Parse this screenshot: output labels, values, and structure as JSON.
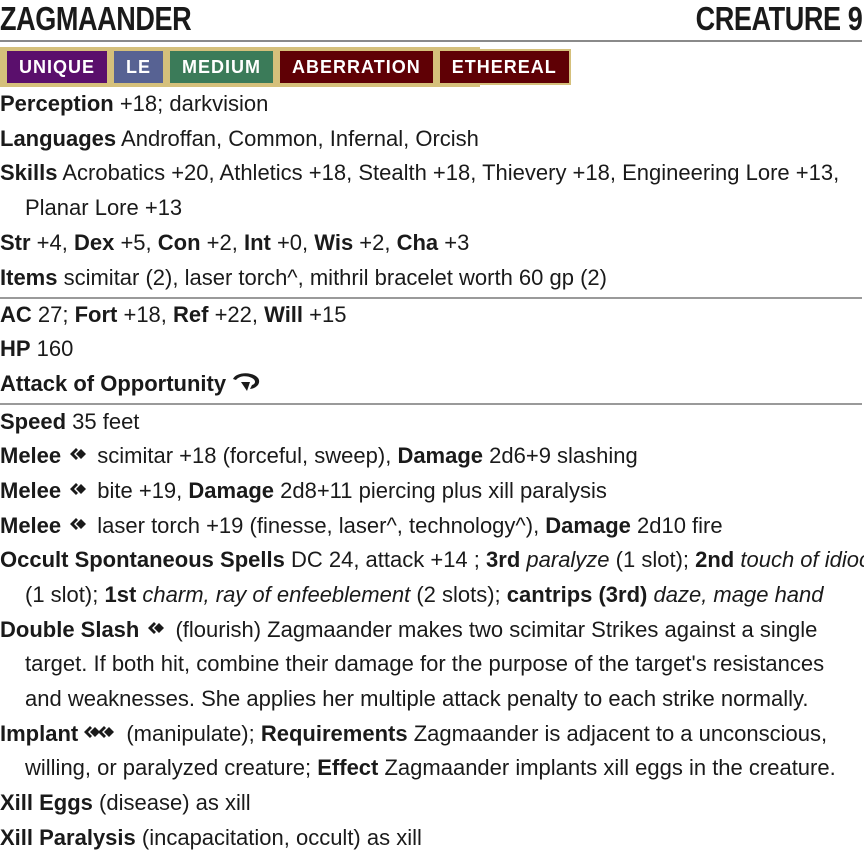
{
  "header": {
    "name": "ZAGMAANDER",
    "level": "CREATURE 9"
  },
  "traits": [
    {
      "label": "UNIQUE",
      "color": "#5a0f6c"
    },
    {
      "label": "LE",
      "color": "#576293"
    },
    {
      "label": "MEDIUM",
      "color": "#3b7b59"
    },
    {
      "label": "ABERRATION",
      "color": "#5f0005"
    },
    {
      "label": "ETHEREAL",
      "color": "#5f0005"
    }
  ],
  "perception": {
    "label": "Perception",
    "value": " +18; darkvision"
  },
  "languages": {
    "label": "Languages",
    "value": " Androffan, Common, Infernal, Orcish"
  },
  "skills": {
    "label": "Skills",
    "line1": " Acrobatics +20, Athletics +18, Stealth +18, Thievery +18, Engineering Lore +13,",
    "line2": "Planar Lore +13"
  },
  "abilities": {
    "str_label": "Str",
    "str": " +4, ",
    "dex_label": "Dex",
    "dex": " +5, ",
    "con_label": "Con",
    "con": " +2, ",
    "int_label": "Int",
    "int": " +0, ",
    "wis_label": "Wis",
    "wis": " +2, ",
    "cha_label": "Cha",
    "cha": " +3"
  },
  "items": {
    "label": "Items",
    "value": " scimitar (2), laser torch^, mithril bracelet worth 60 gp (2)"
  },
  "defense": {
    "ac_label": "AC",
    "ac": " 27; ",
    "fort_label": "Fort",
    "fort": " +18, ",
    "ref_label": "Ref",
    "ref": " +22, ",
    "will_label": "Will",
    "will": " +15"
  },
  "hp": {
    "label": "HP",
    "value": " 160"
  },
  "reaction": {
    "label": "Attack of Opportunity"
  },
  "speed": {
    "label": "Speed",
    "value": " 35 feet"
  },
  "strikes": [
    {
      "label": "Melee",
      "text": " scimitar +18 (forceful, sweep), ",
      "damage_label": "Damage",
      "damage": " 2d6+9 slashing"
    },
    {
      "label": "Melee",
      "text": " bite +19, ",
      "damage_label": "Damage",
      "damage": " 2d8+11 piercing plus xill paralysis"
    },
    {
      "label": "Melee",
      "text": " laser torch +19 (finesse, laser^, technology^), ",
      "damage_label": "Damage",
      "damage": " 2d10 fire"
    }
  ],
  "spells": {
    "label": "Occult Spontaneous Spells",
    "dc": " DC 24, attack +14 ; ",
    "rank3_label": "3rd",
    "rank3_spells": "paralyze",
    "rank3_slots": " (1 slot); ",
    "rank2_label": "2nd",
    "rank2_spells": "touch of idiocy",
    "rank2_slots": "(1 slot); ",
    "rank1_label": "1st",
    "rank1_spells": "charm, ray of enfeeblement",
    "rank1_slots": " (2 slots); ",
    "cantrips_label": "cantrips (3rd)",
    "cantrips_spells": "daze, mage hand"
  },
  "double_slash": {
    "label": "Double Slash",
    "line1": " (flourish) Zagmaander makes two scimitar Strikes against a single",
    "line2": "target. If both hit, combine their damage for the purpose of the target's resistances",
    "line3": "and weaknesses. She applies her multiple attack penalty to each strike normally."
  },
  "implant": {
    "label": "Implant",
    "traits": " (manipulate); ",
    "req_label": "Requirements",
    "req": " Zagmaander is adjacent to a unconscious,",
    "line2a": "willing, or paralyzed creature; ",
    "effect_label": "Effect",
    "effect": " Zagmaander implants xill eggs in the creature."
  },
  "xill_eggs": {
    "label": "Xill Eggs",
    "value": " (disease) as xill"
  },
  "xill_paralysis": {
    "label": "Xill Paralysis",
    "value": " (incapacitation, occult) as xill"
  }
}
